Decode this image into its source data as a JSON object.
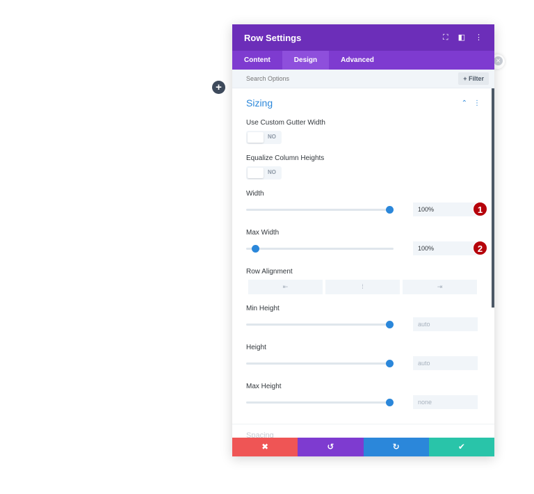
{
  "modal": {
    "title": "Row Settings",
    "header_icons": [
      "expand-icon",
      "sidebar-icon",
      "more-vertical-icon"
    ],
    "tabs": [
      {
        "label": "Content",
        "active": false
      },
      {
        "label": "Design",
        "active": true
      },
      {
        "label": "Advanced",
        "active": false
      }
    ],
    "search": {
      "placeholder": "Search Options",
      "filter_label": "+ Filter"
    },
    "section": {
      "title": "Sizing"
    },
    "fields": {
      "custom_gutter": {
        "label": "Use Custom Gutter Width",
        "state": "NO"
      },
      "equalize_heights": {
        "label": "Equalize Column Heights",
        "state": "NO"
      },
      "width": {
        "label": "Width",
        "value": "100%",
        "badge": "1",
        "slider_pct": 100
      },
      "max_width": {
        "label": "Max Width",
        "value": "100%",
        "badge": "2",
        "slider_pct": 4
      },
      "row_alignment": {
        "label": "Row Alignment",
        "options": [
          "⇤",
          "⁞",
          "⇥"
        ]
      },
      "min_height": {
        "label": "Min Height",
        "value": "auto",
        "slider_pct": 100
      },
      "height": {
        "label": "Height",
        "value": "auto",
        "slider_pct": 100
      },
      "max_height": {
        "label": "Max Height",
        "value": "none",
        "slider_pct": 100
      }
    },
    "next_section_label": "Spacing",
    "footer": {
      "cancel": "✖",
      "undo": "↺",
      "redo": "↻",
      "save": "✔",
      "colors": {
        "cancel": "#ef5555",
        "undo": "#7e3bd0",
        "redo": "#2b87da",
        "save": "#29c4a9"
      }
    }
  },
  "page": {
    "add_button": "+"
  },
  "colors": {
    "header": "#6c2eb9",
    "tabs": "#7e3bd0",
    "accent": "#2b87da",
    "badge": "#b5030b"
  }
}
